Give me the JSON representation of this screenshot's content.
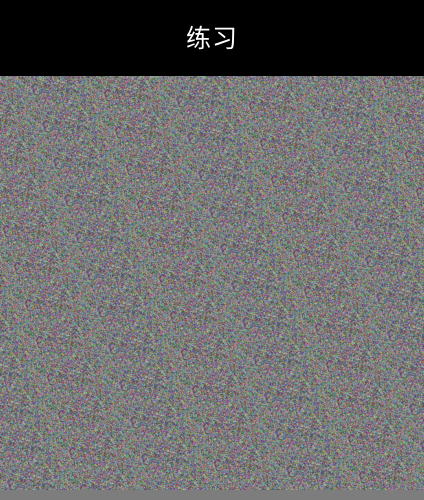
{
  "header": {
    "title": "练习"
  },
  "colors": {
    "header_background": "#000000",
    "title_text": "#ffffff",
    "image_base_gray": "#7a7a7c",
    "bottom_strip": "#7d7d7d"
  },
  "content": {
    "image_type": "random-color-noise"
  }
}
